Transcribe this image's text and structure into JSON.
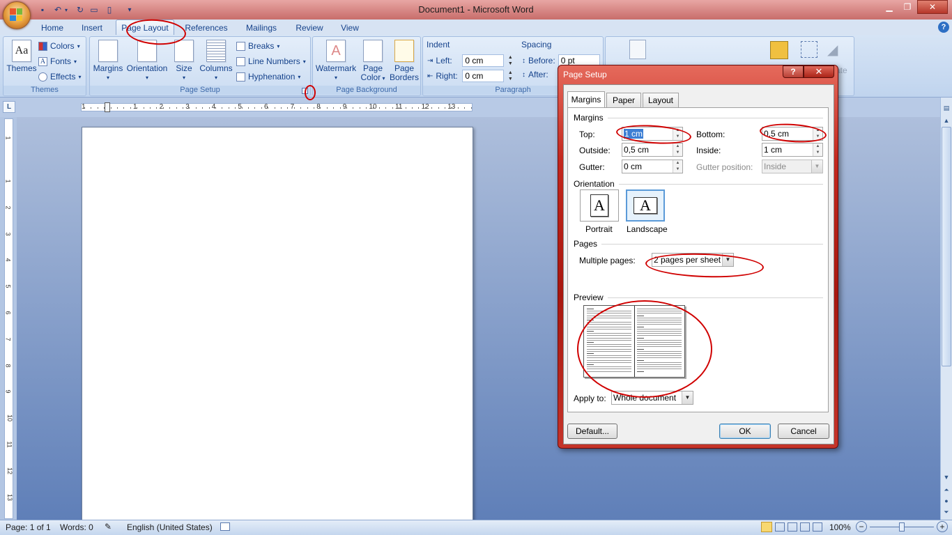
{
  "titlebar": {
    "title": "Document1 - Microsoft Word",
    "qat_customize": "▾",
    "min": "▁",
    "max": "❐",
    "close": "✕"
  },
  "tabs": [
    "Home",
    "Insert",
    "Page Layout",
    "References",
    "Mailings",
    "Review",
    "View"
  ],
  "active_tab": "Page Layout",
  "help_glyph": "?",
  "ribbon": {
    "themes": {
      "label": "Themes",
      "themes_btn": "Themes",
      "colors": "Colors",
      "fonts": "Fonts",
      "effects": "Effects"
    },
    "page_setup": {
      "label": "Page Setup",
      "margins": "Margins",
      "orientation": "Orientation",
      "size": "Size",
      "columns": "Columns",
      "breaks": "Breaks",
      "line_numbers": "Line Numbers",
      "hyphenation": "Hyphenation"
    },
    "page_background": {
      "label": "Page Background",
      "watermark": "Watermark",
      "page_color_1": "Page",
      "page_color_2": "Color",
      "page_borders_1": "Page",
      "page_borders_2": "Borders"
    },
    "paragraph": {
      "label": "Paragraph",
      "indent": "Indent",
      "left_label": "Left:",
      "left_value": "0 cm",
      "right_label": "Right:",
      "right_value": "0 cm",
      "spacing": "Spacing",
      "before_label": "Before:",
      "before_value": "0 pt",
      "after_label": "After:"
    },
    "arrange_partial": "ate"
  },
  "ruler_tab_glyph": "L",
  "ruler_numbers": [
    "1",
    "1",
    "2",
    "3",
    "4",
    "5",
    "6",
    "7",
    "8",
    "9",
    "10",
    "11",
    "12",
    "13"
  ],
  "vruler_numbers": [
    "1",
    "1",
    "2",
    "3",
    "4",
    "5",
    "6",
    "7",
    "8",
    "9",
    "10",
    "11",
    "12",
    "13"
  ],
  "status": {
    "page": "Page: 1 of 1",
    "words": "Words: 0",
    "language": "English (United States)",
    "zoom": "100%",
    "zoom_minus": "−",
    "zoom_plus": "+"
  },
  "dialog": {
    "title": "Page Setup",
    "help": "?",
    "close": "✕",
    "tabs": [
      "Margins",
      "Paper",
      "Layout"
    ],
    "active_tab": "Margins",
    "margins_section": "Margins",
    "top_label": "Top:",
    "top_value": "1 cm",
    "bottom_label": "Bottom:",
    "bottom_value": "0,5 cm",
    "outside_label": "Outside:",
    "outside_value": "0,5 cm",
    "inside_label": "Inside:",
    "inside_value": "1 cm",
    "gutter_label": "Gutter:",
    "gutter_value": "0 cm",
    "gutter_pos_label": "Gutter position:",
    "gutter_pos_value": "Inside",
    "orientation_section": "Orientation",
    "portrait": "Portrait",
    "landscape": "Landscape",
    "orientation_glyph": "A",
    "pages_section": "Pages",
    "multiple_pages_label": "Multiple pages:",
    "multiple_pages_value": "2 pages per sheet",
    "preview_section": "Preview",
    "apply_to_label": "Apply to:",
    "apply_to_value": "Whole document",
    "default_btn": "Default...",
    "ok_btn": "OK",
    "cancel_btn": "Cancel"
  },
  "colors": {
    "dialog_frame": "#c3271d",
    "annotation_red": "#d00000",
    "ribbon_text": "#15428b"
  }
}
